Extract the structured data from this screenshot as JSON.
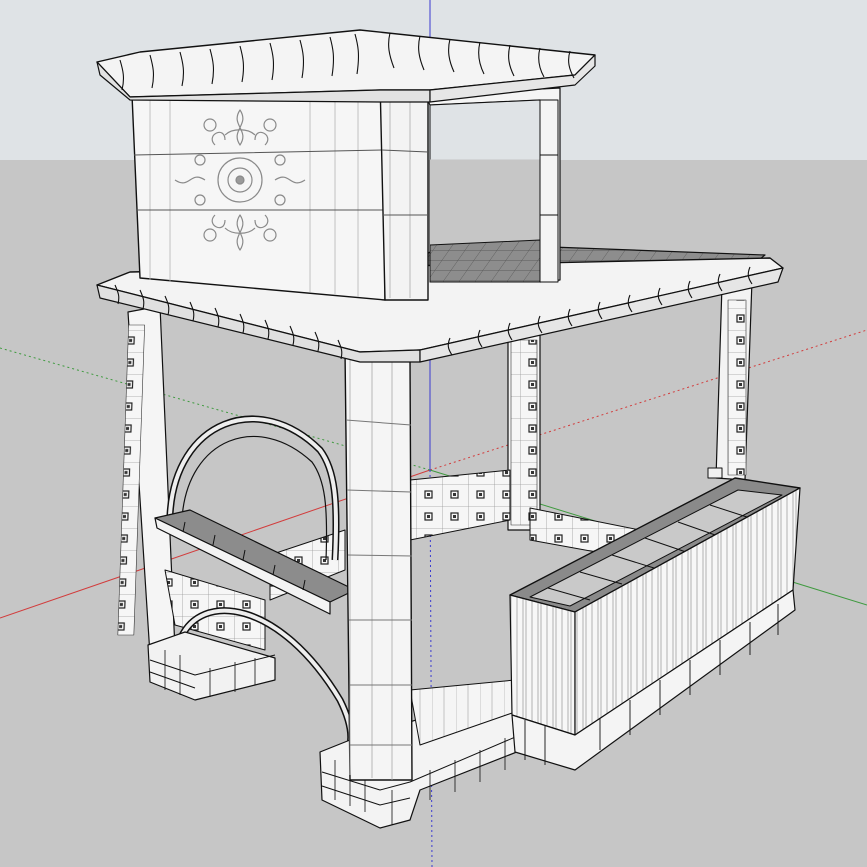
{
  "app": {
    "view": "3d-modeling-viewport",
    "environment": {
      "sky_color": "#dfe3e6",
      "ground_color": "#c6c6c6"
    },
    "axes": [
      {
        "name": "red-axis",
        "color": "#d23c3c"
      },
      {
        "name": "green-axis",
        "color": "#3f9a3f"
      },
      {
        "name": "blue-axis",
        "color": "#3a3ad0"
      }
    ]
  },
  "model": {
    "kind": "pavilion",
    "parts": [
      "upper-cornice",
      "upper-room",
      "ornamental-relief-panel",
      "upper-window-opening",
      "roof-deck",
      "main-cornice",
      "front-left-column",
      "front-right-column",
      "back-left-column",
      "back-middle-column",
      "back-right-column",
      "left-arch",
      "left-balustrade-rail",
      "rear-low-wall",
      "right-railing-counter",
      "front-base-step"
    ],
    "colors": {
      "face": "#f4f4f4",
      "shadow_face": "#e2e2e2",
      "edge": "#111111",
      "roof_tile": "#8a8a8a"
    }
  }
}
